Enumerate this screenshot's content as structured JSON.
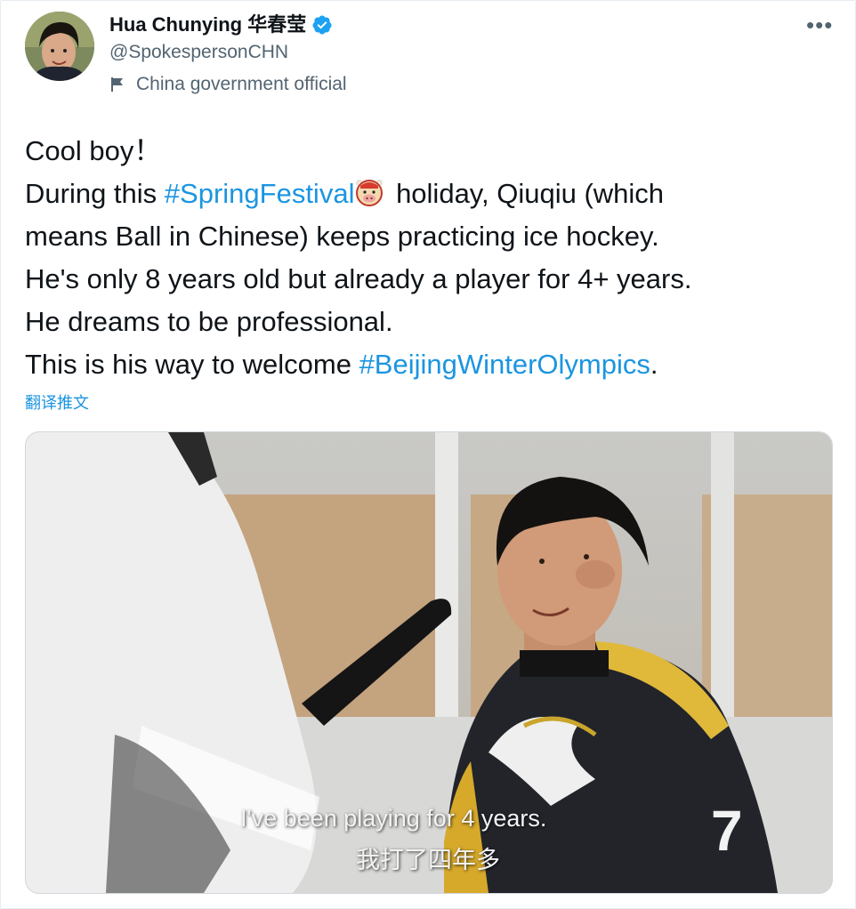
{
  "author": {
    "name": "Hua Chunying 华春莹",
    "handle": "@SpokespersonCHN",
    "label": "China government official"
  },
  "tweet": {
    "line1": "Cool boy！",
    "line2_prefix": "During this ",
    "hashtag1": "#SpringFestival",
    "line2_suffix": " holiday, Qiuqiu (which",
    "line3": "means Ball in Chinese) keeps practicing ice hockey.",
    "line4": "He's only 8 years old but already a player for 4+ years.",
    "line5": "He dreams to be professional.",
    "line6_prefix": "This is his way to welcome ",
    "hashtag2": "#BeijingWinterOlympics",
    "line6_suffix": "."
  },
  "translate_label": "翻译推文",
  "media": {
    "subtitle_en": "I've been playing for 4 years.",
    "subtitle_cn": "我打了四年多",
    "jersey_number": "7"
  },
  "icons": {
    "more": "more-horizontal-icon",
    "verified": "verified-badge-icon",
    "label": "flag-icon",
    "emoji": "ox-face-emoji-icon"
  },
  "colors": {
    "link": "#1b95e0",
    "secondary": "#536471",
    "verified": "#1da1f2"
  }
}
